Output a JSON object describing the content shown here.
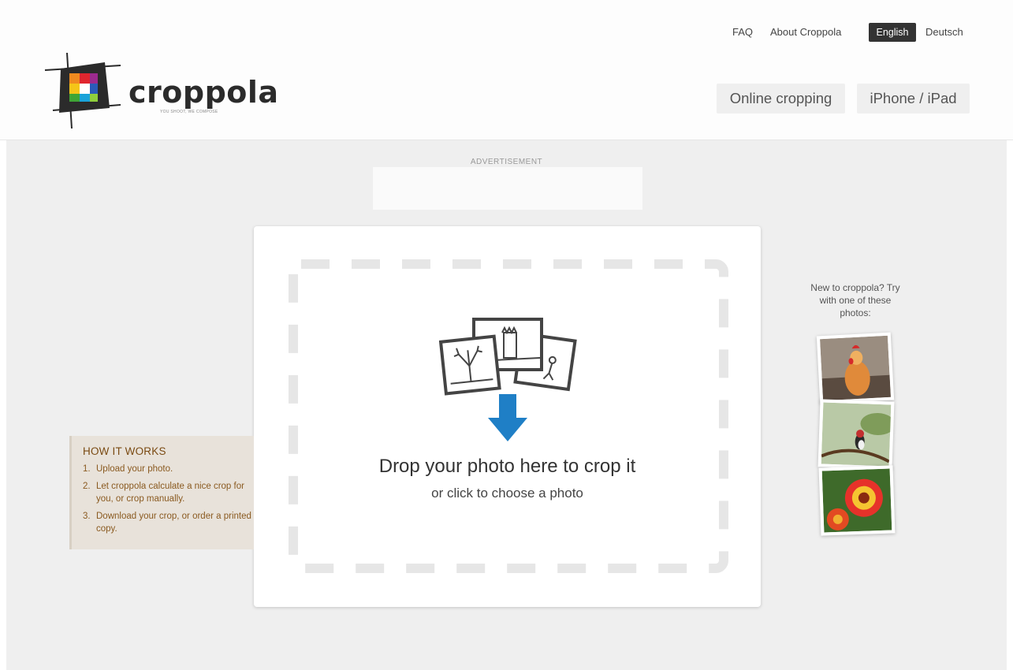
{
  "header": {
    "logo_text": "croppola",
    "logo_tagline": "YOU SHOOT, WE COMPOSE",
    "links": {
      "faq": "FAQ",
      "about": "About Croppola",
      "lang_active": "English",
      "lang_other": "Deutsch"
    },
    "nav": {
      "online": "Online cropping",
      "ios": "iPhone / iPad"
    }
  },
  "ad": {
    "label": "ADVERTISEMENT"
  },
  "dropzone": {
    "title": "Drop your photo here to crop it",
    "subtitle": "or click to choose a photo"
  },
  "how_it_works": {
    "title": "HOW IT WORKS",
    "steps": [
      {
        "num": "1.",
        "text": "Upload your photo."
      },
      {
        "num": "2.",
        "text": "Let croppola calculate a nice crop for you, or crop manually."
      },
      {
        "num": "3.",
        "text": "Download your crop, or order a printed copy."
      }
    ]
  },
  "samples": {
    "intro": "New to croppola? Try with one of these photos:",
    "photos": [
      "rooster-figurine",
      "bird-on-branch",
      "orange-flowers"
    ]
  },
  "colors": {
    "accent_blue": "#1f7fc6",
    "dark": "#333333",
    "howto_bg": "#e8e2da",
    "howto_text": "#8a5a20"
  }
}
